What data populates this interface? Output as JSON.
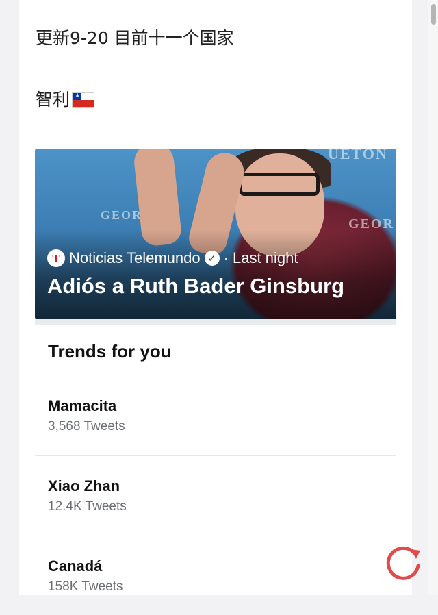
{
  "post": {
    "headline": "更新9-20 目前十一个国家",
    "country_label": "智利",
    "country_flag": "chile-flag-icon"
  },
  "news_card": {
    "source": "Noticias Telemundo",
    "time": "· Last night",
    "title": "Adiós a Ruth Bader Ginsburg",
    "source_logo_letter": "T",
    "background_signage": [
      "GEOR",
      "GEOR",
      "UETON"
    ]
  },
  "trends": {
    "header": "Trends for you",
    "items": [
      {
        "name": "Mamacita",
        "count": "3,568 Tweets"
      },
      {
        "name": "Xiao Zhan",
        "count": "12.4K Tweets"
      },
      {
        "name": "Canadá",
        "count": "158K Tweets"
      }
    ]
  },
  "colors": {
    "accent_refresh": "#e24a4a",
    "card_bg": "#3d7fb4",
    "muted_text": "#6b6f74"
  }
}
